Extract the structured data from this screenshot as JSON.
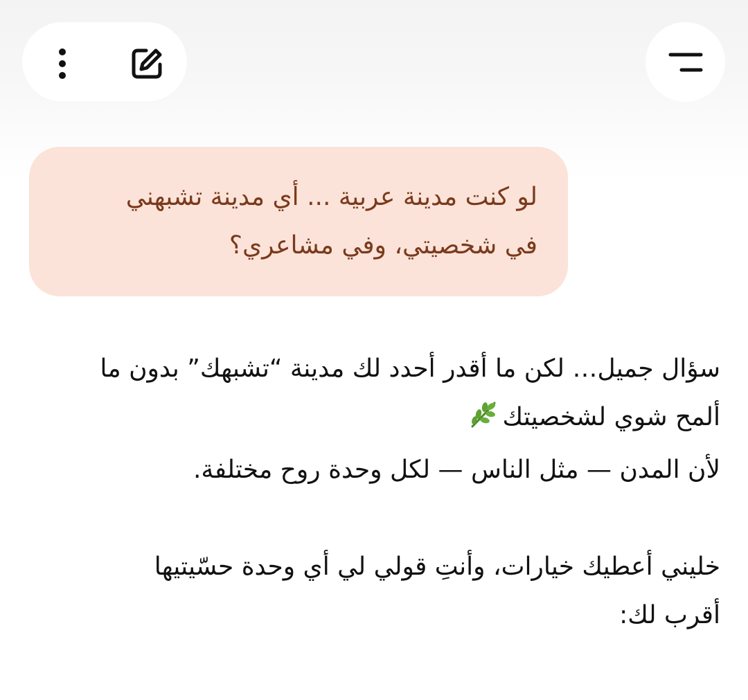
{
  "toolbar": {
    "more_icon": "more-vertical-icon",
    "edit_icon": "edit-icon",
    "menu_icon": "menu-icon"
  },
  "user_message": {
    "lines": [
      "لو كنت مدينة عربية ... أي مدينة تشبهني",
      "في شخصيتي، وفي مشاعري؟"
    ]
  },
  "assistant_message": {
    "paragraph1": [
      "سؤال جميل… لكن ما أقدر أحدد لك مدينة “تشبهك” بدون ما",
      "ألمح شوي لشخصيتك",
      "لأن المدن — مثل الناس — لكل وحدة روح مختلفة."
    ],
    "paragraph2": [
      "خليني أعطيك خيارات، وأنتِ قولي لي أي وحدة حسّيتيها",
      "أقرب لك:"
    ],
    "emoji_icon": "herb-icon"
  },
  "colors": {
    "user_bubble_bg": "#fbe3d9",
    "user_text": "#7a3a1c",
    "body_text": "#111111"
  }
}
